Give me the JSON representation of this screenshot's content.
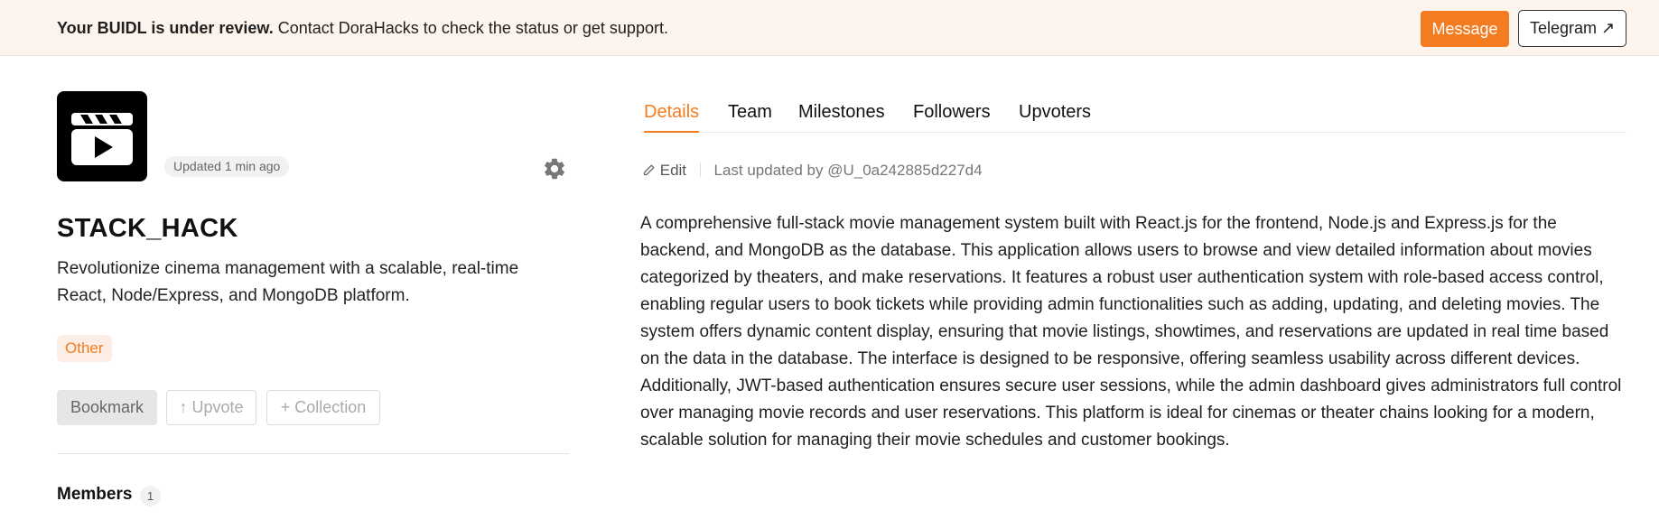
{
  "banner": {
    "strong": "Your BUIDL is under review.",
    "text": "Contact DoraHacks to check the status or get support.",
    "message_label": "Message",
    "telegram_label": "Telegram ↗"
  },
  "project": {
    "updated": "Updated 1 min ago",
    "title": "STACK_HACK",
    "description": "Revolutionize cinema management with a scalable, real-time React, Node/Express, and MongoDB platform.",
    "tag": "Other",
    "actions": {
      "bookmark": "Bookmark",
      "upvote": "↑ Upvote",
      "collection": "+ Collection"
    },
    "members_label": "Members",
    "members_count": "1"
  },
  "tabs": [
    "Details",
    "Team",
    "Milestones",
    "Followers",
    "Upvoters"
  ],
  "details": {
    "edit_label": "Edit",
    "last_updated": "Last updated by @U_0a242885d227d4",
    "body": "A comprehensive full-stack movie management system built with React.js for the frontend, Node.js and Express.js for the backend, and MongoDB as the database. This application allows users to browse and view detailed information about movies categorized by theaters, and make reservations. It features a robust user authentication system with role-based access control, enabling regular users to book tickets while providing admin functionalities such as adding, updating, and deleting movies. The system offers dynamic content display, ensuring that movie listings, showtimes, and reservations are updated in real time based on the data in the database. The interface is designed to be responsive, offering seamless usability across different devices. Additionally, JWT-based authentication ensures secure user sessions, while the admin dashboard gives administrators full control over managing movie records and user reservations. This platform is ideal for cinemas or theater chains looking for a modern, scalable solution for managing their movie schedules and customer bookings."
  },
  "icons": {
    "logo": "clapperboard-icon",
    "settings": "gear-icon",
    "edit": "pencil-icon"
  },
  "colors": {
    "accent": "#f37c20",
    "banner_bg": "#fdf4ee",
    "tag_bg": "#fdeee5"
  }
}
